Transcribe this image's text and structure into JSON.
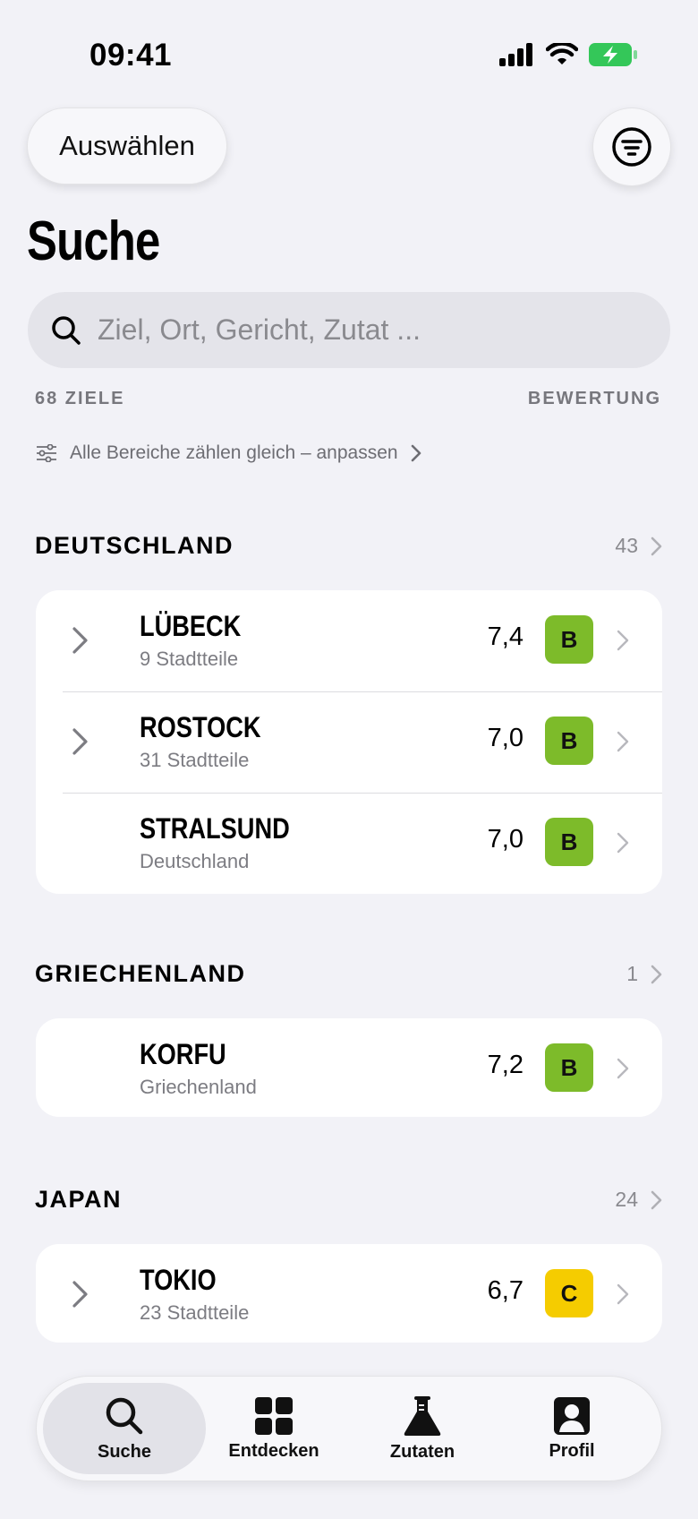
{
  "status_bar": {
    "time": "09:41"
  },
  "header": {
    "select_label": "Auswählen",
    "title": "Suche"
  },
  "search": {
    "placeholder": "Ziel, Ort, Gericht, Zutat ..."
  },
  "summary": {
    "count_label": "68 ZIELE",
    "sort_label": "BEWERTUNG",
    "weighting_label": "Alle Bereiche zählen gleich – anpassen"
  },
  "sections": [
    {
      "title": "DEUTSCHLAND",
      "count": "43",
      "rows": [
        {
          "city": "LÜBECK",
          "sub": "9 Stadtteile",
          "score": "7,4",
          "grade": "B"
        },
        {
          "city": "ROSTOCK",
          "sub": "31 Stadtteile",
          "score": "7,0",
          "grade": "B"
        },
        {
          "city": "STRALSUND",
          "sub": "Deutschland",
          "score": "7,0",
          "grade": "B"
        }
      ]
    },
    {
      "title": "GRIECHENLAND",
      "count": "1",
      "rows": [
        {
          "city": "KORFU",
          "sub": "Griechenland",
          "score": "7,2",
          "grade": "B"
        }
      ]
    },
    {
      "title": "JAPAN",
      "count": "24",
      "rows": [
        {
          "city": "TOKIO",
          "sub": "23 Stadtteile",
          "score": "6,7",
          "grade": "C"
        }
      ]
    }
  ],
  "tabbar": {
    "tabs": [
      {
        "label": "Suche",
        "icon": "search-icon",
        "active": true
      },
      {
        "label": "Entdecken",
        "icon": "grid-icon",
        "active": false
      },
      {
        "label": "Zutaten",
        "icon": "flask-icon",
        "active": false
      },
      {
        "label": "Profil",
        "icon": "person-icon",
        "active": false
      }
    ]
  },
  "colors": {
    "grade_b": "#7dbb2a",
    "grade_c": "#f5cc00",
    "battery": "#34c759",
    "background": "#f2f2f7"
  }
}
